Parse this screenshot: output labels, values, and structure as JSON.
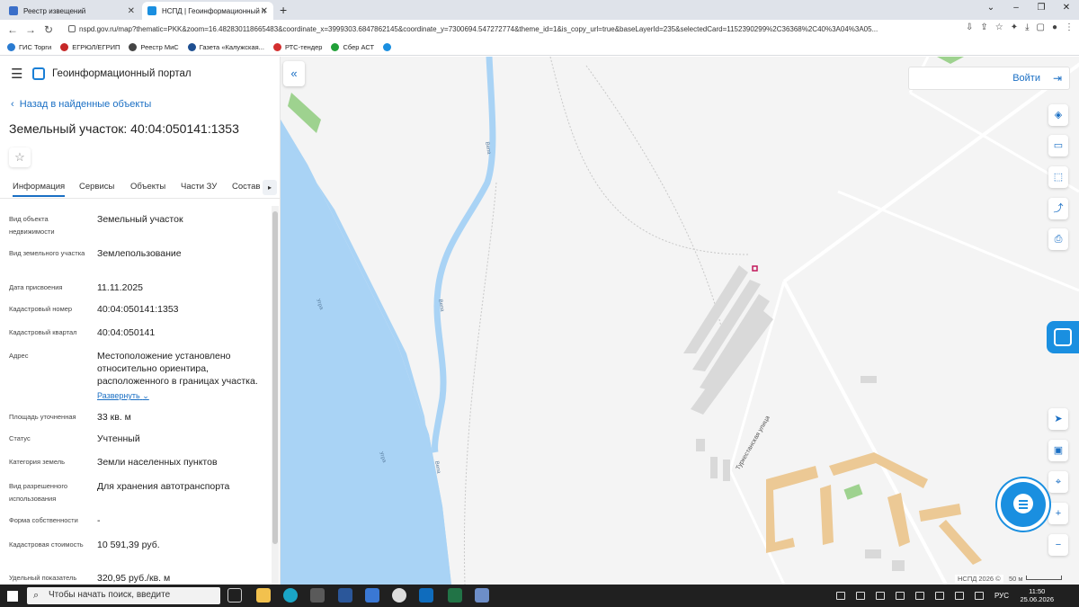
{
  "browser": {
    "tabs": [
      {
        "title": "Реестр извещений",
        "favicon_color": "#3b6fc9"
      },
      {
        "title": "НСПД | Геоинформационный п",
        "favicon_color": "#1a8fe0"
      }
    ],
    "url": "nspd.gov.ru/map?thematic=PKK&zoom=16.482830118665483&coordinate_x=3999303.6847862145&coordinate_y=7300694.547272774&theme_id=1&is_copy_url=true&baseLayerId=235&selectedCard=1152390299%2C36368%2C40%3A04%3A05...",
    "bookmarks": [
      {
        "label": "ГИС Торги",
        "color": "#2a7bd1"
      },
      {
        "label": "ЕГРЮЛ/ЕГРИП",
        "color": "#c62828"
      },
      {
        "label": "Реестр МиС",
        "color": "#444444"
      },
      {
        "label": "Газета «Калужская...",
        "color": "#1e4f91"
      },
      {
        "label": "РТС-тендер",
        "color": "#d32f2f"
      },
      {
        "label": "Сбер АСТ",
        "color": "#21a038"
      },
      {
        "label": "",
        "color": "#1a8fe0"
      }
    ]
  },
  "panel": {
    "portal_title": "Геоинформационный портал",
    "back_label": "Назад в найденные объекты",
    "object_title": "Земельный участок: 40:04:050141:1353",
    "tabs": [
      "Информация",
      "Сервисы",
      "Объекты",
      "Части ЗУ",
      "Состав"
    ],
    "fields": [
      {
        "label": "Вид объекта недвижимости",
        "value": "Земельный участок"
      },
      {
        "label": "Вид земельного участка",
        "value": "Землепользование"
      },
      {
        "label": "Дата присвоения",
        "value": "11.11.2025"
      },
      {
        "label": "Кадастровый номер",
        "value": "40:04:050141:1353"
      },
      {
        "label": "Кадастровый квартал",
        "value": "40:04:050141"
      },
      {
        "label": "Адрес",
        "value": "Местоположение установлено относительно ориентира, расположенного в границах участка.",
        "link": "Развернуть"
      },
      {
        "label": "Площадь уточненная",
        "value": "33 кв. м"
      },
      {
        "label": "Статус",
        "value": "Учтенный"
      },
      {
        "label": "Категория земель",
        "value": "Земли населенных пунктов"
      },
      {
        "label": "Вид разрешенного использования",
        "value": "Для хранения автотранспорта"
      },
      {
        "label": "Форма собственности",
        "value": "-"
      },
      {
        "label": "Кадастровая стоимость",
        "value": "10 591,39 руб."
      },
      {
        "label": "Удельный показатель",
        "value": "320,95 руб./кв. м"
      }
    ]
  },
  "map": {
    "login_label": "Войти",
    "street_label": "Туркестанская улица",
    "river_labels": [
      "Угра",
      "Угра",
      "Вепа",
      "Вепа",
      "Вепа"
    ],
    "copyright": "НСПД 2026 ©",
    "scale_label": "50 м",
    "colors": {
      "water": "#a9d3f5",
      "building": "#d9d9d9",
      "residential": "#ecc995",
      "green": "#9ed28f",
      "selected": "#c2185b"
    }
  },
  "taskbar": {
    "search_placeholder": "Чтобы начать поиск, введите",
    "lang": "РУС",
    "time": "11:50",
    "date": "25.06.2026"
  }
}
